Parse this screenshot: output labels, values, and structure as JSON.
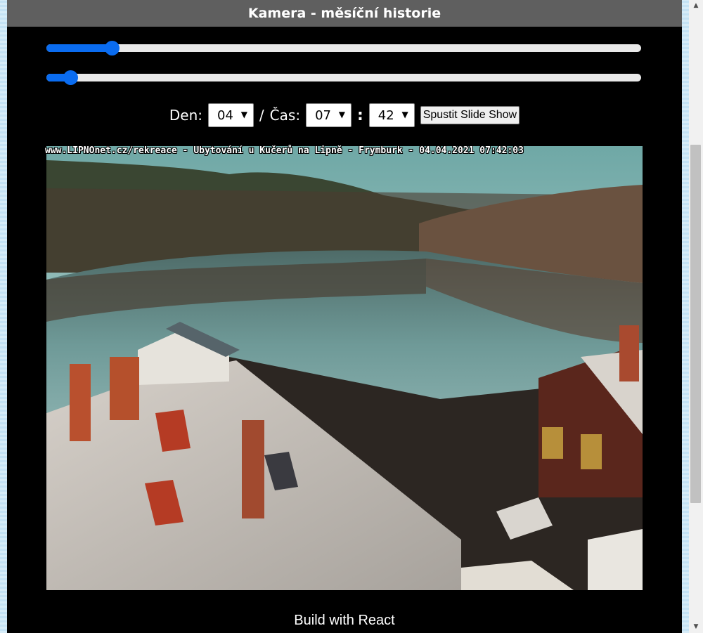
{
  "header": {
    "title": "Kamera - měsíční historie"
  },
  "sliders": {
    "day": {
      "value_percent": 11
    },
    "time": {
      "value_percent": 4
    }
  },
  "controls": {
    "day_label": "Den:",
    "day_value": "04",
    "separator": "/",
    "time_label": "Čas:",
    "hour_value": "07",
    "colon": ":",
    "minute_value": "42",
    "slideshow_button": "Spustit Slide Show"
  },
  "camera": {
    "overlay_text": "www.LIPNOnet.cz/rekreace - Ubytování u Kučerů na Lipně - Frymburk - 04.04.2021 07:42:03"
  },
  "footer": {
    "text": "Build with React"
  },
  "colors": {
    "accent": "#0a6cf0",
    "header_bg": "#5f5f5f",
    "panel_bg": "#000000"
  },
  "icons": {
    "dropdown": "chevron-down-icon",
    "scroll_up": "arrow-up-icon",
    "scroll_down": "arrow-down-icon"
  }
}
